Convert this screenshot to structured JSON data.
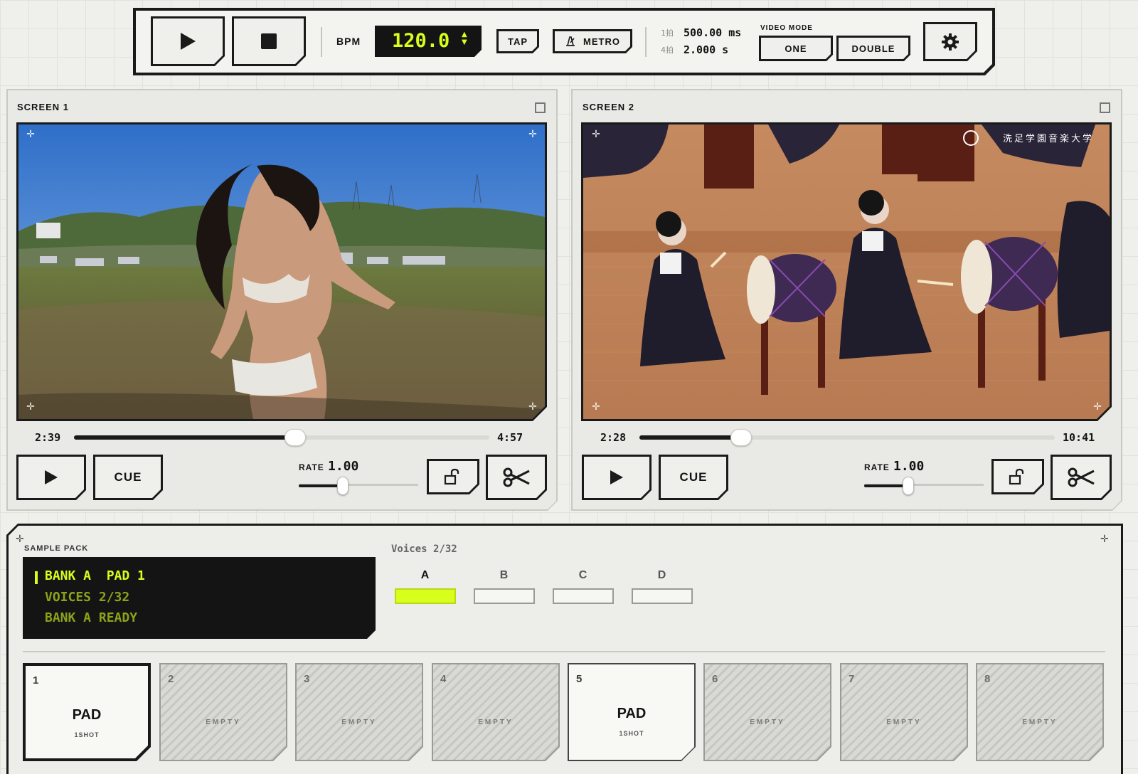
{
  "transport": {
    "play_icon": "play-icon",
    "stop_icon": "stop-icon",
    "bpm_label": "BPM",
    "bpm_value": "120.0",
    "tap_label": "TAP",
    "metro_label": "METRO",
    "beat1_label": "1拍",
    "beat1_value": "500.00 ms",
    "beat4_label": "4拍",
    "beat4_value": "2.000 s",
    "video_mode_label": "VIDEO MODE",
    "mode_one": "ONE",
    "mode_double": "DOUBLE",
    "active_mode": "DOUBLE",
    "settings_icon": "gear-icon"
  },
  "screens": [
    {
      "title": "SCREEN 1",
      "time_current": "2:39",
      "time_total": "4:57",
      "progress": 0.533,
      "cue_label": "CUE",
      "rate_label": "RATE",
      "rate_value": "1.00",
      "rate_position": 0.37
    },
    {
      "title": "SCREEN 2",
      "time_current": "2:28",
      "time_total": "10:41",
      "progress": 0.245,
      "watermark": "洗足学園音楽大学",
      "cue_label": "CUE",
      "rate_label": "RATE",
      "rate_value": "1.00",
      "rate_position": 0.37
    }
  ],
  "sample_pack": {
    "title": "SAMPLE PACK",
    "display_lines": [
      "BANK A  PAD 1",
      "VOICES 2/32",
      "BANK A READY"
    ],
    "voices_label": "Voices 2/32",
    "banks": [
      "A",
      "B",
      "C",
      "D"
    ],
    "active_bank": "A",
    "pads": [
      {
        "num": "1",
        "title": "PAD",
        "sub": "1SHOT",
        "state": "loaded"
      },
      {
        "num": "2",
        "label": "EMPTY",
        "state": "empty"
      },
      {
        "num": "3",
        "label": "EMPTY",
        "state": "empty"
      },
      {
        "num": "4",
        "label": "EMPTY",
        "state": "empty"
      },
      {
        "num": "5",
        "title": "PAD",
        "sub": "1SHOT",
        "state": "loaded"
      },
      {
        "num": "6",
        "label": "EMPTY",
        "state": "empty"
      },
      {
        "num": "7",
        "label": "EMPTY",
        "state": "empty"
      },
      {
        "num": "8",
        "label": "EMPTY",
        "state": "empty"
      }
    ]
  },
  "colors": {
    "accent": "#d7ff1b",
    "ink": "#141414",
    "background": "#efefeb"
  }
}
